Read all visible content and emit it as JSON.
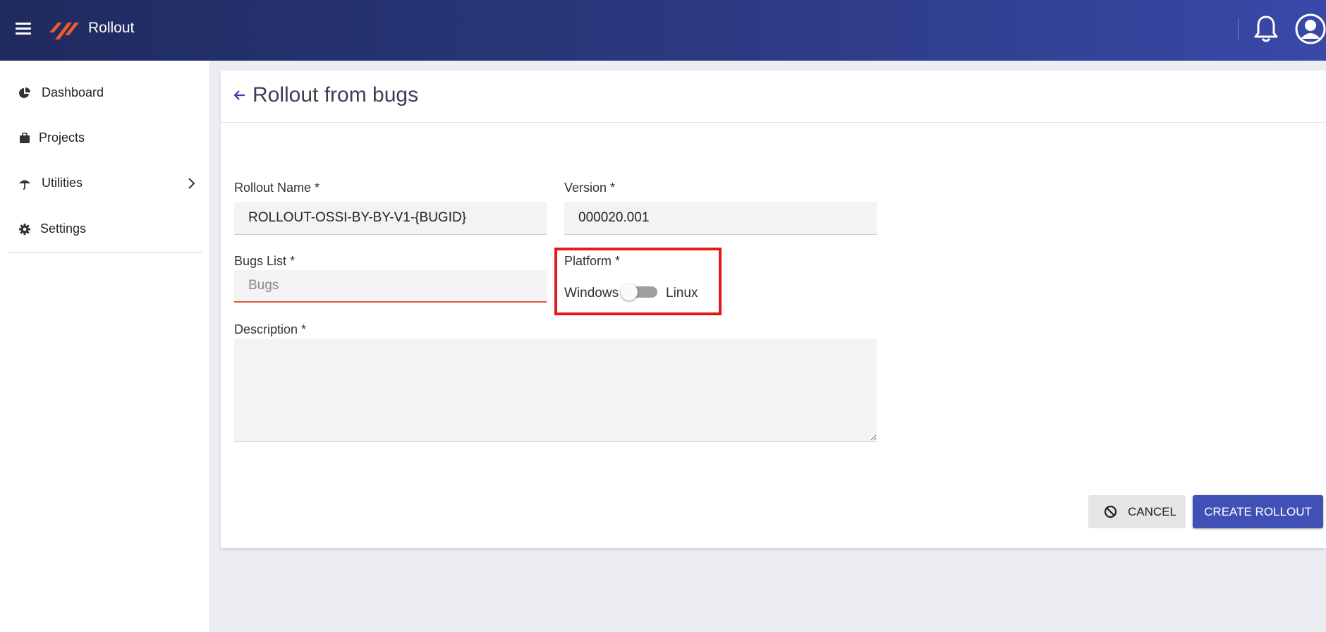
{
  "app": {
    "title": "Rollout"
  },
  "sidebar": {
    "items": [
      {
        "label": "Dashboard",
        "icon": "pie-chart-icon"
      },
      {
        "label": "Projects",
        "icon": "briefcase-icon"
      },
      {
        "label": "Utilities",
        "icon": "umbrella-icon",
        "has_submenu": true
      },
      {
        "label": "Settings",
        "icon": "gear-icon"
      }
    ]
  },
  "page": {
    "title": "Rollout from bugs"
  },
  "form": {
    "rollout_name": {
      "label": "Rollout Name *",
      "value": "ROLLOUT-OSSI-BY-BY-V1-{BUGID}"
    },
    "version": {
      "label": "Version *",
      "value": "000020.001"
    },
    "bugs_list": {
      "label": "Bugs List *",
      "placeholder": "Bugs",
      "value": ""
    },
    "platform": {
      "label": "Platform *",
      "left_option": "Windows",
      "right_option": "Linux",
      "selected": "Windows"
    },
    "description": {
      "label": "Description *",
      "value": ""
    }
  },
  "actions": {
    "cancel_label": "CANCEL",
    "create_label": "CREATE ROLLOUT"
  },
  "colors": {
    "primary": "#3f51b5",
    "header_start": "#1f2a5e",
    "header_end": "#3a48a8",
    "logo": "#ee5a2c",
    "highlight": "#e11b1b",
    "error": "#e05a3f"
  }
}
